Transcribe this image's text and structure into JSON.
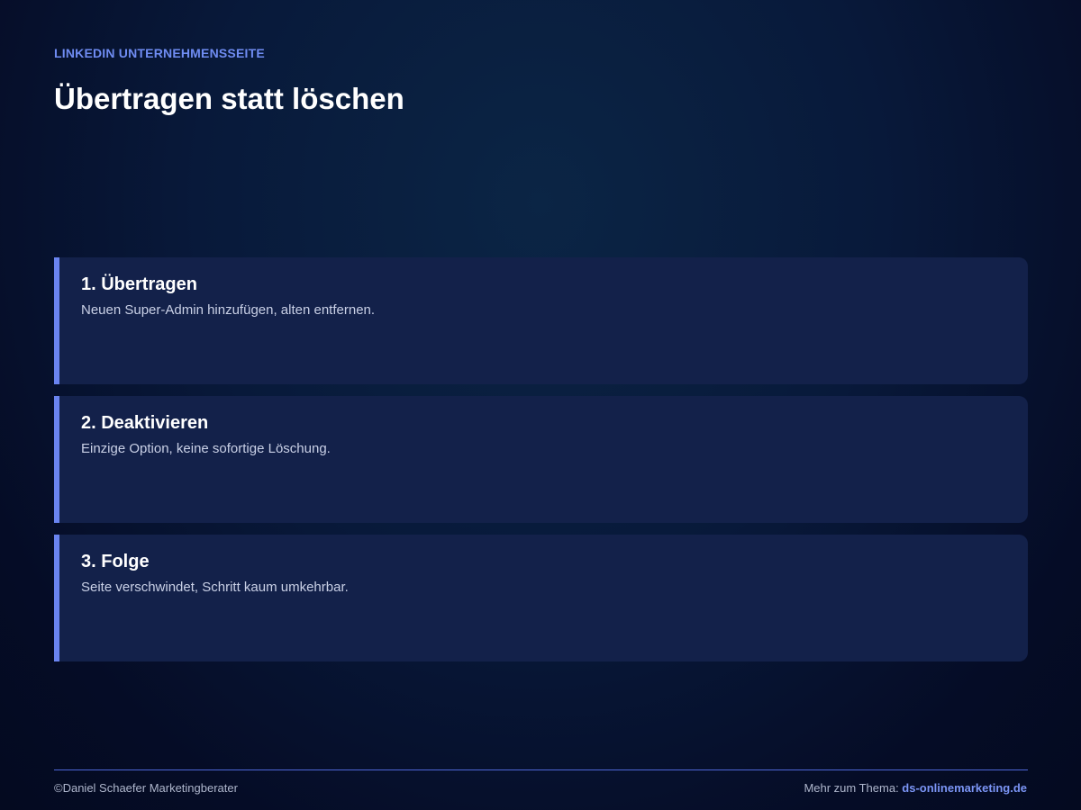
{
  "header": {
    "kicker": "LINKEDIN UNTERNEHMENSSEITE",
    "title": "Übertragen statt löschen"
  },
  "cards": [
    {
      "title": "1. Übertragen",
      "text": "Neuen Super-Admin hinzufügen, alten entfernen."
    },
    {
      "title": "2. Deaktivieren",
      "text": "Einzige Option, keine sofortige Löschung."
    },
    {
      "title": "3. Folge",
      "text": "Seite verschwindet, Schritt kaum umkehrbar."
    }
  ],
  "footer": {
    "copyright": "©Daniel Schaefer Marketingberater",
    "more_label": "Mehr zum Thema: ",
    "link_text": "ds-onlinemarketing.de"
  },
  "colors": {
    "accent": "#6a84f0",
    "card_background": "#13214a",
    "background": "#08193a"
  }
}
